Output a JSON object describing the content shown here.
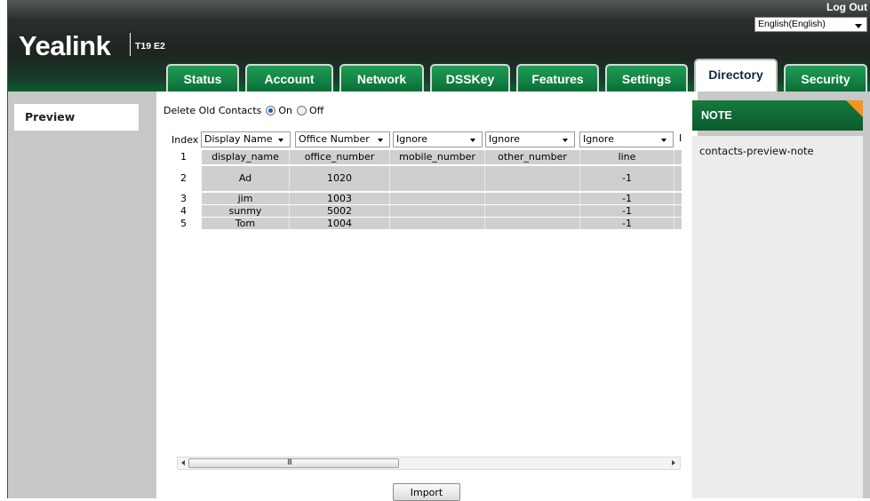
{
  "header": {
    "brand": "Yealink",
    "model": "T19 E2",
    "logout_label": "Log Out",
    "language_selected": "English(English)",
    "tabs": [
      {
        "label": "Status"
      },
      {
        "label": "Account"
      },
      {
        "label": "Network"
      },
      {
        "label": "DSSKey"
      },
      {
        "label": "Features"
      },
      {
        "label": "Settings"
      },
      {
        "label": "Directory",
        "active": true
      },
      {
        "label": "Security"
      }
    ]
  },
  "sidebar": {
    "preview_label": "Preview"
  },
  "delete_old_contacts": {
    "label": "Delete Old Contacts",
    "on_label": "On",
    "off_label": "Off",
    "selected": "On"
  },
  "table": {
    "index_header": "Index",
    "column_selects": [
      "Display Name",
      "Office Number",
      "Ignore",
      "Ignore",
      "Ignore",
      "I"
    ],
    "rows": [
      {
        "index": "1",
        "cells": [
          "display_name",
          "office_number",
          "mobile_number",
          "other_number",
          "line",
          ""
        ]
      },
      {
        "index": "2",
        "cells": [
          "Ad",
          "1020",
          "",
          "",
          "-1",
          ""
        ]
      },
      {
        "index": "3",
        "cells": [
          "jim",
          "1003",
          "",
          "",
          "-1",
          ""
        ]
      },
      {
        "index": "4",
        "cells": [
          "sunmy",
          "5002",
          "",
          "",
          "-1",
          ""
        ]
      },
      {
        "index": "5",
        "cells": [
          "Tom",
          "1004",
          "",
          "",
          "-1",
          ""
        ]
      }
    ]
  },
  "scrollbar": {
    "grip_glyph": "III"
  },
  "import_label": "Import",
  "note": {
    "title": "NOTE",
    "body": "contacts-preview-note"
  },
  "colors": {
    "tab_green": "#0a6e36",
    "note_corner": "#f7941d",
    "side_gray": "#c8c8c8",
    "cell_gray": "#cfcfcf"
  }
}
